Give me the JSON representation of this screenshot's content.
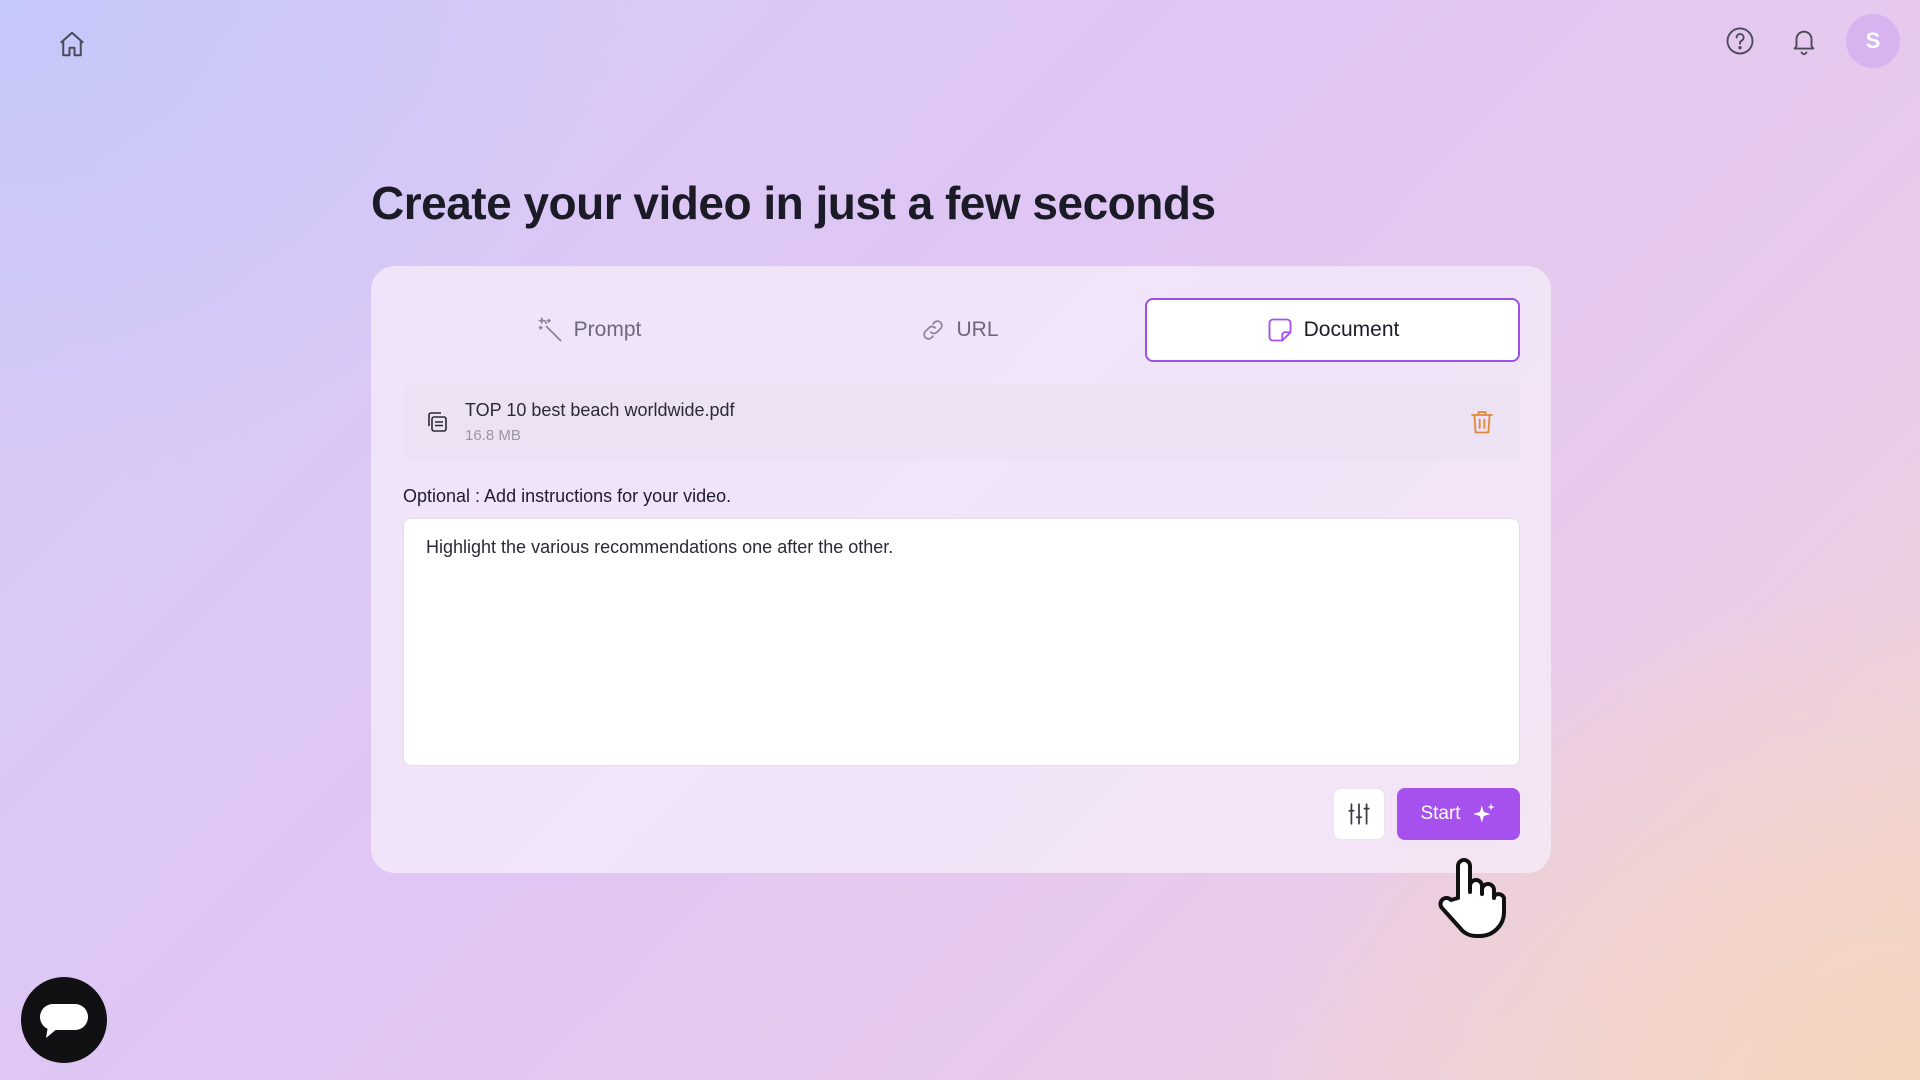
{
  "page": {
    "title": "Create your video in just a few seconds"
  },
  "topbar": {
    "home_icon": "home-icon",
    "help_icon": "help-icon",
    "notification_icon": "bell-icon",
    "avatar_letter": "S"
  },
  "tabs": [
    {
      "label": "Prompt",
      "icon": "magic-wand-icon",
      "active": false
    },
    {
      "label": "URL",
      "icon": "link-icon",
      "active": false
    },
    {
      "label": "Document",
      "icon": "document-icon",
      "active": true
    }
  ],
  "file": {
    "name": "TOP 10 best beach worldwide.pdf",
    "size": "16.8 MB",
    "icon": "file-copy-icon",
    "delete_icon": "trash-icon"
  },
  "instructions": {
    "label": "Optional : Add instructions for your video.",
    "value": "Highlight the various recommendations one after the other."
  },
  "actions": {
    "settings_icon": "sliders-icon",
    "start_label": "Start",
    "start_icon": "sparkles-icon"
  },
  "chat": {
    "icon": "chat-bubble-icon"
  },
  "colors": {
    "accent": "#a650ee",
    "accent_border": "#9b50e6",
    "trash": "#e08a3c"
  }
}
